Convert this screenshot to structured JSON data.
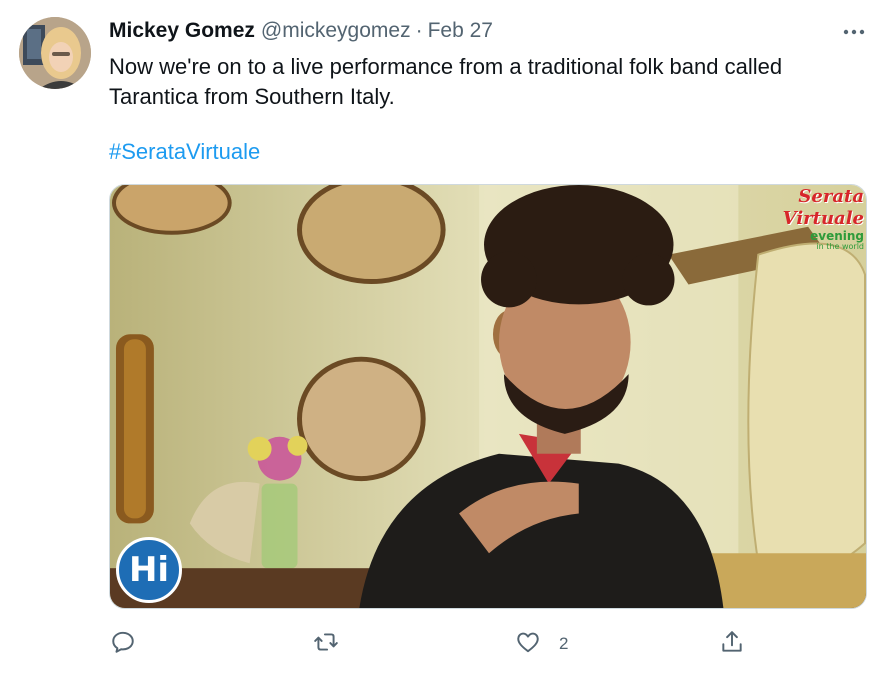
{
  "tweet": {
    "author_name": "Mickey Gomez",
    "author_handle": "@mickeygomez",
    "separator": "·",
    "date": "Feb 27",
    "text": "Now we're on to a live performance from a traditional folk band called Tarantica from Southern Italy.",
    "hashtag": "#SerataVirtuale"
  },
  "media": {
    "overlay_badge_line1": "Serata Virtuale",
    "overlay_badge_line2": "evening",
    "overlay_badge_line3": "in the world",
    "channel_logo": "Hi"
  },
  "actions": {
    "reply_icon": "reply-icon",
    "retweet_icon": "retweet-icon",
    "like_icon": "heart-icon",
    "like_count": "2",
    "share_icon": "share-icon"
  },
  "colors": {
    "link": "#1d9bf0",
    "secondary_text": "#536471",
    "primary_text": "#0f1419"
  }
}
